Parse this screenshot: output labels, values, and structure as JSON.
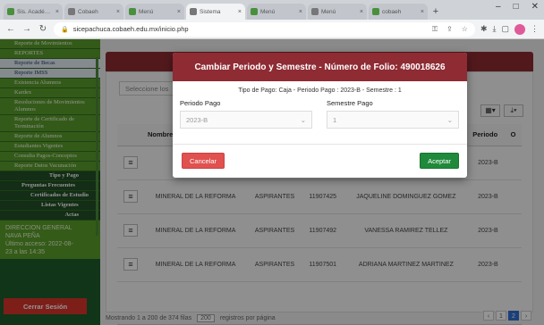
{
  "browser": {
    "tabs": [
      {
        "title": "Sis. Académico"
      },
      {
        "title": "Cobaeh"
      },
      {
        "title": "Menú"
      },
      {
        "title": "Sistema"
      },
      {
        "title": "Menú"
      },
      {
        "title": "Menú"
      },
      {
        "title": "cobaeh"
      }
    ],
    "new_tab": "+",
    "url": "sicepachuca.cobaeh.edu.mx/inicio.php"
  },
  "sidebar": {
    "items": [
      {
        "label": "Reporte de Movimientos",
        "style": "green"
      },
      {
        "label": "REPORTES",
        "style": "green"
      },
      {
        "label": "Reporte de Becas",
        "style": "light"
      },
      {
        "label": "Reporte IMSS",
        "style": "light"
      },
      {
        "label": "Existencia Alumnos",
        "style": "green"
      },
      {
        "label": "Kardex",
        "style": "green"
      },
      {
        "label": "Resoluciones de Movimientos Alumnos",
        "style": "green"
      },
      {
        "label": "Reporte de Certificado de Terminación",
        "style": "green"
      },
      {
        "label": "Reporte de Alumnos",
        "style": "green"
      },
      {
        "label": "Estudiantes Vigentes",
        "style": "green"
      },
      {
        "label": "Consulta Pagos-Conceptos",
        "style": "green"
      },
      {
        "label": "Reporte Datos Vacunación",
        "style": "green"
      },
      {
        "label": "Tipo y Pago",
        "style": "sub-center"
      },
      {
        "label": "Preguntas Frecuentes",
        "style": "sub"
      },
      {
        "label": "Certificados de Estudio",
        "style": "sub2"
      },
      {
        "label": "Listas Vigentes",
        "style": "sub3"
      },
      {
        "label": "Actas",
        "style": "sub-center"
      }
    ],
    "info_lines": [
      "DIRECCION GENERAL",
      "NAVA PEÑA",
      "Último acceso: 2022-08-",
      "23 a las 14:35"
    ],
    "logout_label": "Cerrar Sesión"
  },
  "main": {
    "search_placeholder": "Seleccione los",
    "toolbar_icons": [
      "columns-icon",
      "export-icon"
    ],
    "table": {
      "columns": [
        "",
        "Nombre",
        "",
        "",
        "",
        "Periodo",
        "O"
      ],
      "rows": [
        {
          "municipio": "MINERAL DE LA REFORMA",
          "tipo": "ASPIRANTES",
          "folio": "11907425",
          "alumno": "JAQUELINE DOMINGUEZ GOMEZ",
          "periodo": "2023-B"
        },
        {
          "municipio": "MINERAL DE LA REFORMA",
          "tipo": "ASPIRANTES",
          "folio": "11907492",
          "alumno": "VANESSA RAMIREZ TELLEZ",
          "periodo": "2023-B"
        },
        {
          "municipio": "MINERAL DE LA REFORMA",
          "tipo": "ASPIRANTES",
          "folio": "11907501",
          "alumno": "ADRIANA MARTINEZ MARTINEZ",
          "periodo": "2023-B"
        }
      ],
      "partial_row": {
        "municipio": "MIN",
        "periodo": "2023-B"
      }
    },
    "footer": {
      "showing": "Mostrando 1 a 200 de 374 filas",
      "page_size": "200",
      "per_page_label": "registros por página"
    },
    "pager": [
      "‹",
      "1",
      "2",
      "›"
    ]
  },
  "modal": {
    "title": "Cambiar Periodo y Semestre - Número de Folio: 490018626",
    "info": "Tipo de Pago: Caja - Periodo Pago : 2023-B - Semestre : 1",
    "periodo_label": "Periodo Pago",
    "periodo_value": "2023-B",
    "semestre_label": "Semestre Pago",
    "semestre_value": "1",
    "cancel_label": "Cancelar",
    "accept_label": "Aceptar"
  }
}
